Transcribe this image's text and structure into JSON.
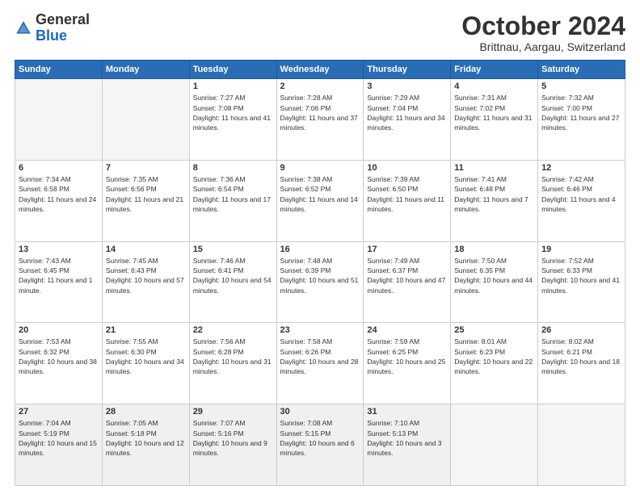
{
  "logo": {
    "general": "General",
    "blue": "Blue"
  },
  "header": {
    "title": "October 2024",
    "location": "Brittnau, Aargau, Switzerland"
  },
  "weekdays": [
    "Sunday",
    "Monday",
    "Tuesday",
    "Wednesday",
    "Thursday",
    "Friday",
    "Saturday"
  ],
  "weeks": [
    [
      {
        "day": "",
        "empty": true
      },
      {
        "day": "",
        "empty": true
      },
      {
        "day": "1",
        "sunrise": "7:27 AM",
        "sunset": "7:08 PM",
        "daylight": "11 hours and 41 minutes."
      },
      {
        "day": "2",
        "sunrise": "7:28 AM",
        "sunset": "7:06 PM",
        "daylight": "11 hours and 37 minutes."
      },
      {
        "day": "3",
        "sunrise": "7:29 AM",
        "sunset": "7:04 PM",
        "daylight": "11 hours and 34 minutes."
      },
      {
        "day": "4",
        "sunrise": "7:31 AM",
        "sunset": "7:02 PM",
        "daylight": "11 hours and 31 minutes."
      },
      {
        "day": "5",
        "sunrise": "7:32 AM",
        "sunset": "7:00 PM",
        "daylight": "11 hours and 27 minutes."
      }
    ],
    [
      {
        "day": "6",
        "sunrise": "7:34 AM",
        "sunset": "6:58 PM",
        "daylight": "11 hours and 24 minutes."
      },
      {
        "day": "7",
        "sunrise": "7:35 AM",
        "sunset": "6:56 PM",
        "daylight": "11 hours and 21 minutes."
      },
      {
        "day": "8",
        "sunrise": "7:36 AM",
        "sunset": "6:54 PM",
        "daylight": "11 hours and 17 minutes."
      },
      {
        "day": "9",
        "sunrise": "7:38 AM",
        "sunset": "6:52 PM",
        "daylight": "11 hours and 14 minutes."
      },
      {
        "day": "10",
        "sunrise": "7:39 AM",
        "sunset": "6:50 PM",
        "daylight": "11 hours and 11 minutes."
      },
      {
        "day": "11",
        "sunrise": "7:41 AM",
        "sunset": "6:48 PM",
        "daylight": "11 hours and 7 minutes."
      },
      {
        "day": "12",
        "sunrise": "7:42 AM",
        "sunset": "6:46 PM",
        "daylight": "11 hours and 4 minutes."
      }
    ],
    [
      {
        "day": "13",
        "sunrise": "7:43 AM",
        "sunset": "6:45 PM",
        "daylight": "11 hours and 1 minute."
      },
      {
        "day": "14",
        "sunrise": "7:45 AM",
        "sunset": "6:43 PM",
        "daylight": "10 hours and 57 minutes."
      },
      {
        "day": "15",
        "sunrise": "7:46 AM",
        "sunset": "6:41 PM",
        "daylight": "10 hours and 54 minutes."
      },
      {
        "day": "16",
        "sunrise": "7:48 AM",
        "sunset": "6:39 PM",
        "daylight": "10 hours and 51 minutes."
      },
      {
        "day": "17",
        "sunrise": "7:49 AM",
        "sunset": "6:37 PM",
        "daylight": "10 hours and 47 minutes."
      },
      {
        "day": "18",
        "sunrise": "7:50 AM",
        "sunset": "6:35 PM",
        "daylight": "10 hours and 44 minutes."
      },
      {
        "day": "19",
        "sunrise": "7:52 AM",
        "sunset": "6:33 PM",
        "daylight": "10 hours and 41 minutes."
      }
    ],
    [
      {
        "day": "20",
        "sunrise": "7:53 AM",
        "sunset": "6:32 PM",
        "daylight": "10 hours and 38 minutes."
      },
      {
        "day": "21",
        "sunrise": "7:55 AM",
        "sunset": "6:30 PM",
        "daylight": "10 hours and 34 minutes."
      },
      {
        "day": "22",
        "sunrise": "7:56 AM",
        "sunset": "6:28 PM",
        "daylight": "10 hours and 31 minutes."
      },
      {
        "day": "23",
        "sunrise": "7:58 AM",
        "sunset": "6:26 PM",
        "daylight": "10 hours and 28 minutes."
      },
      {
        "day": "24",
        "sunrise": "7:59 AM",
        "sunset": "6:25 PM",
        "daylight": "10 hours and 25 minutes."
      },
      {
        "day": "25",
        "sunrise": "8:01 AM",
        "sunset": "6:23 PM",
        "daylight": "10 hours and 22 minutes."
      },
      {
        "day": "26",
        "sunrise": "8:02 AM",
        "sunset": "6:21 PM",
        "daylight": "10 hours and 18 minutes."
      }
    ],
    [
      {
        "day": "27",
        "sunrise": "7:04 AM",
        "sunset": "5:19 PM",
        "daylight": "10 hours and 15 minutes."
      },
      {
        "day": "28",
        "sunrise": "7:05 AM",
        "sunset": "5:18 PM",
        "daylight": "10 hours and 12 minutes."
      },
      {
        "day": "29",
        "sunrise": "7:07 AM",
        "sunset": "5:16 PM",
        "daylight": "10 hours and 9 minutes."
      },
      {
        "day": "30",
        "sunrise": "7:08 AM",
        "sunset": "5:15 PM",
        "daylight": "10 hours and 6 minutes."
      },
      {
        "day": "31",
        "sunrise": "7:10 AM",
        "sunset": "5:13 PM",
        "daylight": "10 hours and 3 minutes."
      },
      {
        "day": "",
        "empty": true
      },
      {
        "day": "",
        "empty": true
      }
    ]
  ]
}
